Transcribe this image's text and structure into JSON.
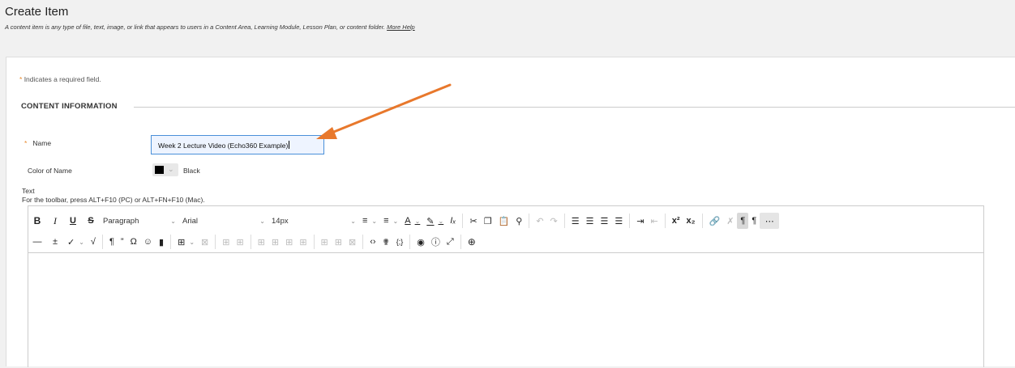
{
  "header": {
    "title": "Create Item",
    "description": "A content item is any type of file, text, image, or link that appears to users in a Content Area, Learning Module, Lesson Plan, or content folder.",
    "help_link": "More Help"
  },
  "form": {
    "required_star": "*",
    "required_note": "Indicates a required field.",
    "section_title": "CONTENT INFORMATION",
    "name_label": "Name",
    "name_value": "Week 2 Lecture Video (Echo360 Example)",
    "color_label": "Color of Name",
    "color_value": "Black",
    "text_label": "Text",
    "toolbar_hint": "For the toolbar, press ALT+F10 (PC) or ALT+FN+F10 (Mac)."
  },
  "toolbar": {
    "paragraph": "Paragraph",
    "font": "Arial",
    "size": "14px"
  },
  "colors": {
    "accent_arrow": "#e8782c",
    "required_star": "#e8892c",
    "input_border": "#4a90d9"
  }
}
